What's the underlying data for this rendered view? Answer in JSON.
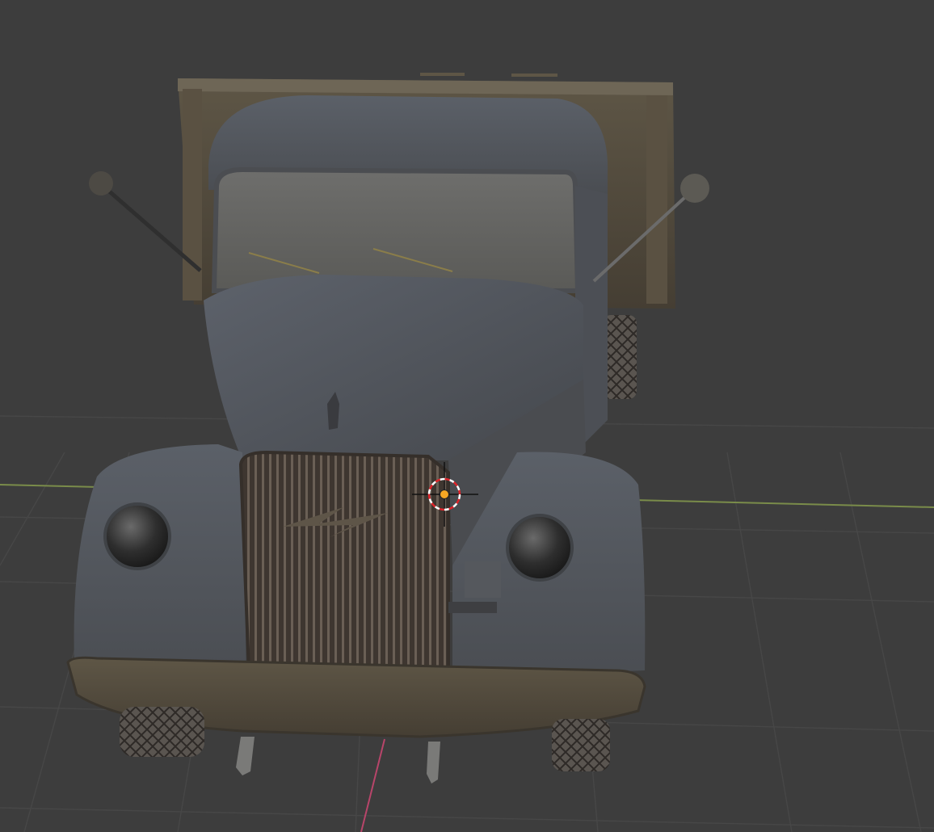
{
  "viewport": {
    "view": "3d-viewport",
    "background_color": "#3d3d3d",
    "grid_color": "#474747",
    "x_axis_color": "#7a8c4a",
    "y_axis_color": "#b8456a",
    "object": "truck-model",
    "icons": {
      "cursor": "3d-cursor-icon",
      "origin": "object-origin-icon"
    }
  }
}
